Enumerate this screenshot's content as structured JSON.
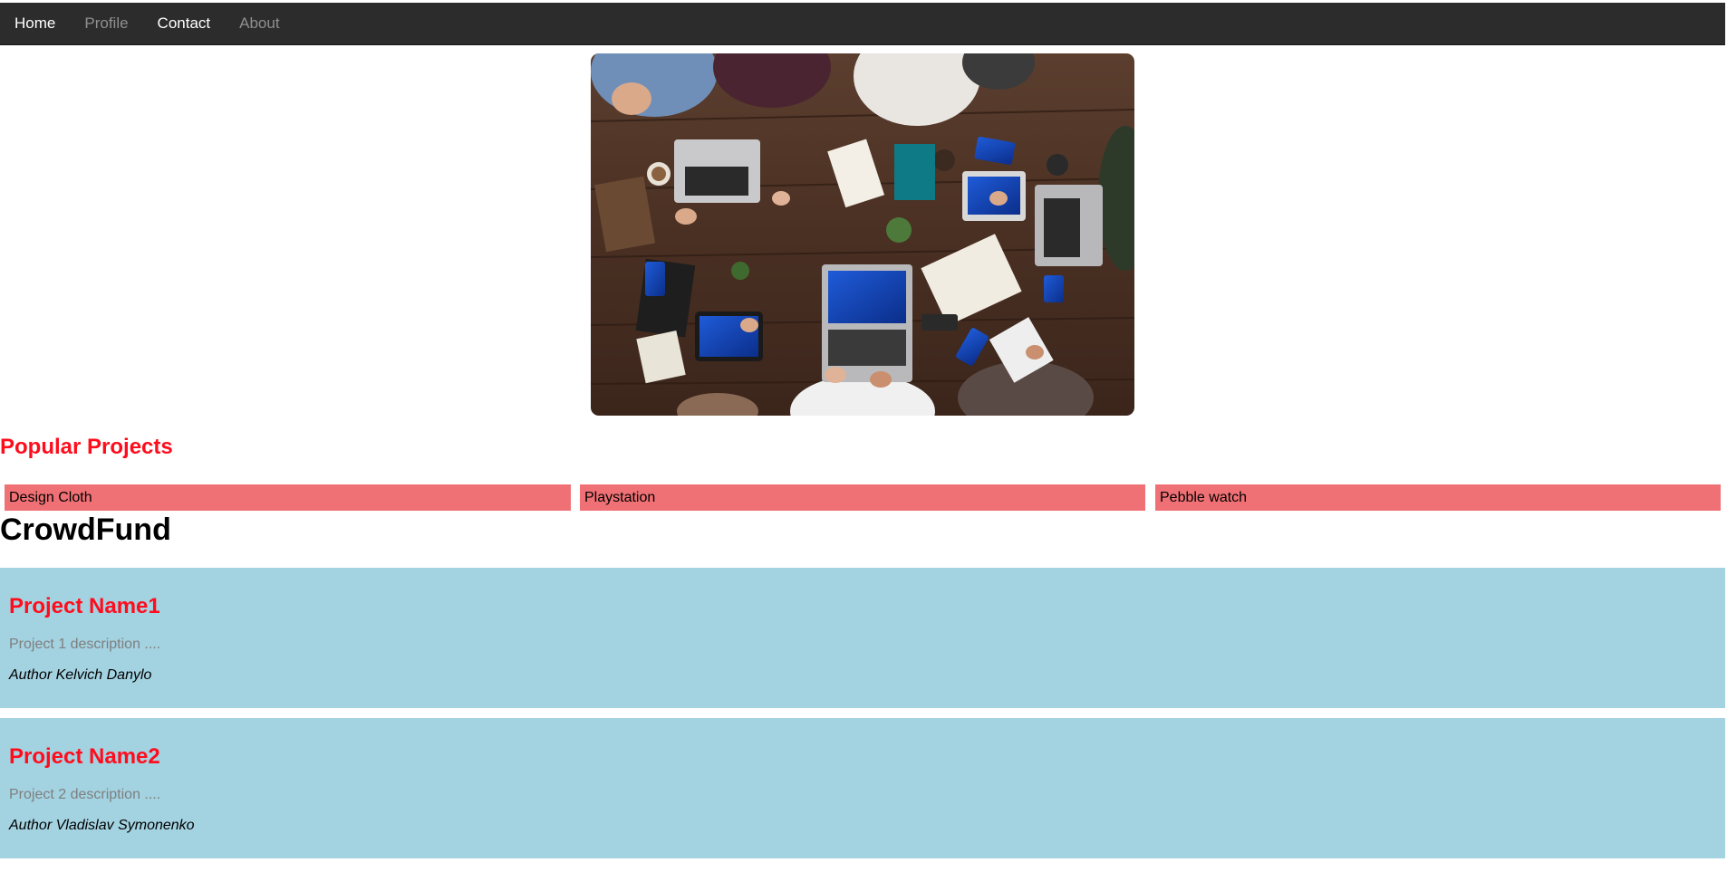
{
  "nav": {
    "items": [
      {
        "label": "Home",
        "active": true
      },
      {
        "label": "Profile",
        "active": false
      },
      {
        "label": "Contact",
        "active": true
      },
      {
        "label": "About",
        "active": false
      }
    ]
  },
  "hero": {
    "image": "team-meeting-photo"
  },
  "popular": {
    "title": "Popular Projects",
    "items": [
      "Design Cloth",
      "Playstation",
      "Pebble watch"
    ]
  },
  "brand": {
    "title": "CrowdFund"
  },
  "projects": [
    {
      "name": "Project Name1",
      "description": "Project 1 description ....",
      "author": "Author Kelvich Danylo"
    },
    {
      "name": "Project Name2",
      "description": "Project 2 description ....",
      "author": "Author Vladislav Symonenko"
    }
  ],
  "colors": {
    "nav_bg": "#2c2c2c",
    "accent_red": "#ff0d1d",
    "popular_bg": "#f07175",
    "card_bg": "#a3d2e1"
  }
}
